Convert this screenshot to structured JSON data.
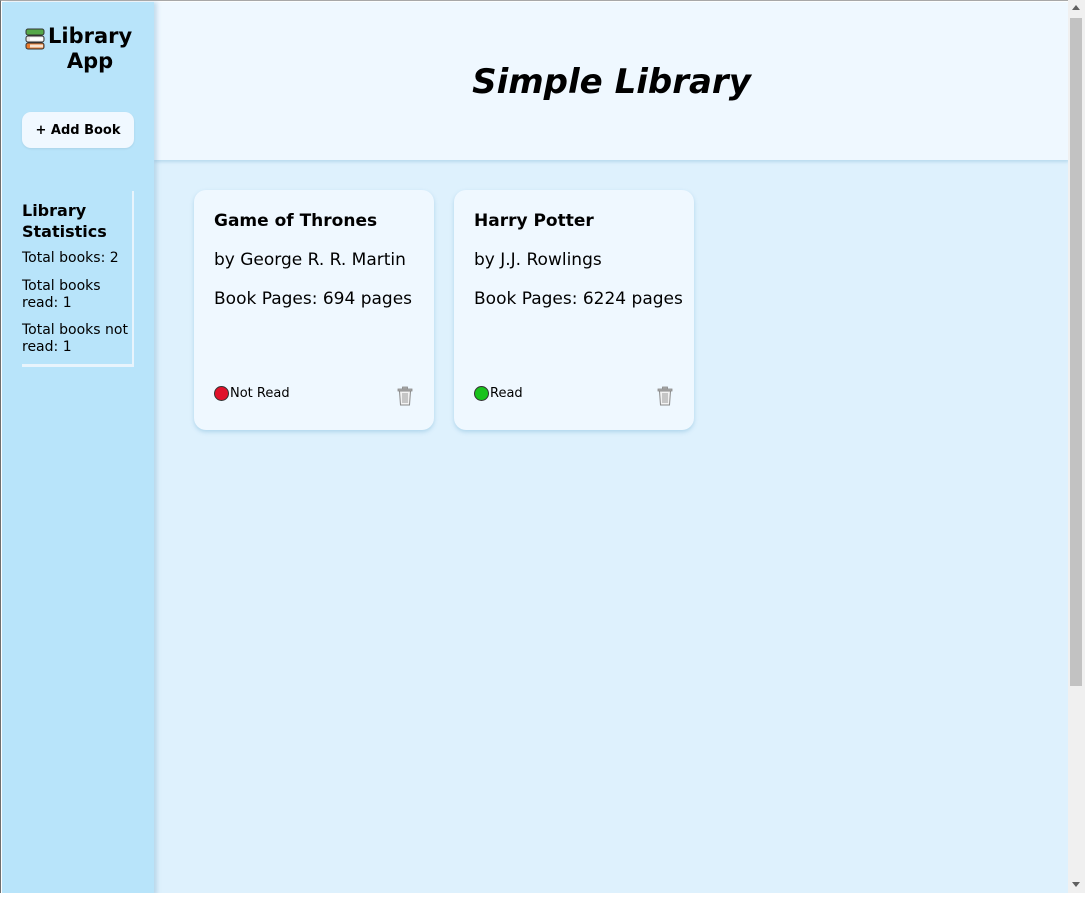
{
  "app": {
    "brand_line1": "Library",
    "brand_line2": "App",
    "brand_icon": "books-stack-icon"
  },
  "sidebar": {
    "add_button_label": "+ Add Book",
    "stats_title": "Library Statistics",
    "total_books": "Total books: 2",
    "total_read": "Total books read: 1",
    "total_not_read": "Total books not read: 1"
  },
  "header": {
    "title": "Simple Library"
  },
  "books": [
    {
      "title": "Game of Thrones",
      "author": "by George R. R. Martin",
      "pages": "Book Pages: 694 pages",
      "status": "Not Read",
      "status_color": "#e0112a"
    },
    {
      "title": "Harry Potter",
      "author": "by J.J. Rowlings",
      "pages": "Book Pages: 6224 pages",
      "status": "Read",
      "status_color": "#19c21c"
    }
  ]
}
